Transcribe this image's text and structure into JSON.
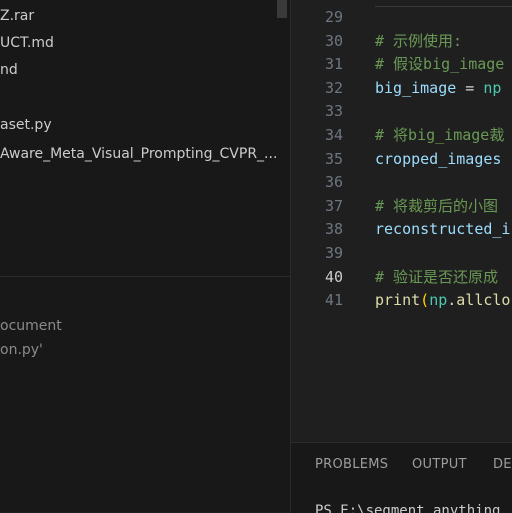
{
  "explorer": {
    "files": [
      "Z.rar",
      "UCT.md",
      "nd",
      "aset.py",
      "Aware_Meta_Visual_Prompting_CVPR_..."
    ],
    "panel_lines": [
      "ocument",
      "on.py'"
    ]
  },
  "editor": {
    "lines": [
      {
        "n": "29",
        "tokens": []
      },
      {
        "n": "30",
        "tokens": [
          {
            "t": "# 示例使用:",
            "c": "c-com"
          }
        ]
      },
      {
        "n": "31",
        "tokens": [
          {
            "t": "# 假设big_image",
            "c": "c-com"
          }
        ]
      },
      {
        "n": "32",
        "tokens": [
          {
            "t": "big_image",
            "c": "c-var"
          },
          {
            "t": " = ",
            "c": "c-op"
          },
          {
            "t": "np",
            "c": "c-mod"
          }
        ]
      },
      {
        "n": "33",
        "tokens": []
      },
      {
        "n": "34",
        "tokens": [
          {
            "t": "# 将big_image裁",
            "c": "c-com"
          }
        ]
      },
      {
        "n": "35",
        "tokens": [
          {
            "t": "cropped_images",
            "c": "c-var"
          }
        ]
      },
      {
        "n": "36",
        "tokens": []
      },
      {
        "n": "37",
        "tokens": [
          {
            "t": "# 将裁剪后的小图",
            "c": "c-com"
          }
        ]
      },
      {
        "n": "38",
        "tokens": [
          {
            "t": "reconstructed_i",
            "c": "c-var"
          }
        ]
      },
      {
        "n": "39",
        "tokens": []
      },
      {
        "n": "40",
        "tokens": [
          {
            "t": "# 验证是否还原成",
            "c": "c-com"
          }
        ],
        "active": true
      },
      {
        "n": "41",
        "tokens": [
          {
            "t": "print",
            "c": "c-fn"
          },
          {
            "t": "(",
            "c": "c-paren"
          },
          {
            "t": "np",
            "c": "c-mod"
          },
          {
            "t": ".",
            "c": "c-op"
          },
          {
            "t": "allclo",
            "c": "c-fn"
          }
        ]
      }
    ]
  },
  "panel": {
    "tabs": [
      "PROBLEMS",
      "OUTPUT",
      "DE"
    ],
    "terminal_text": "PS E:\\segment_anything"
  }
}
